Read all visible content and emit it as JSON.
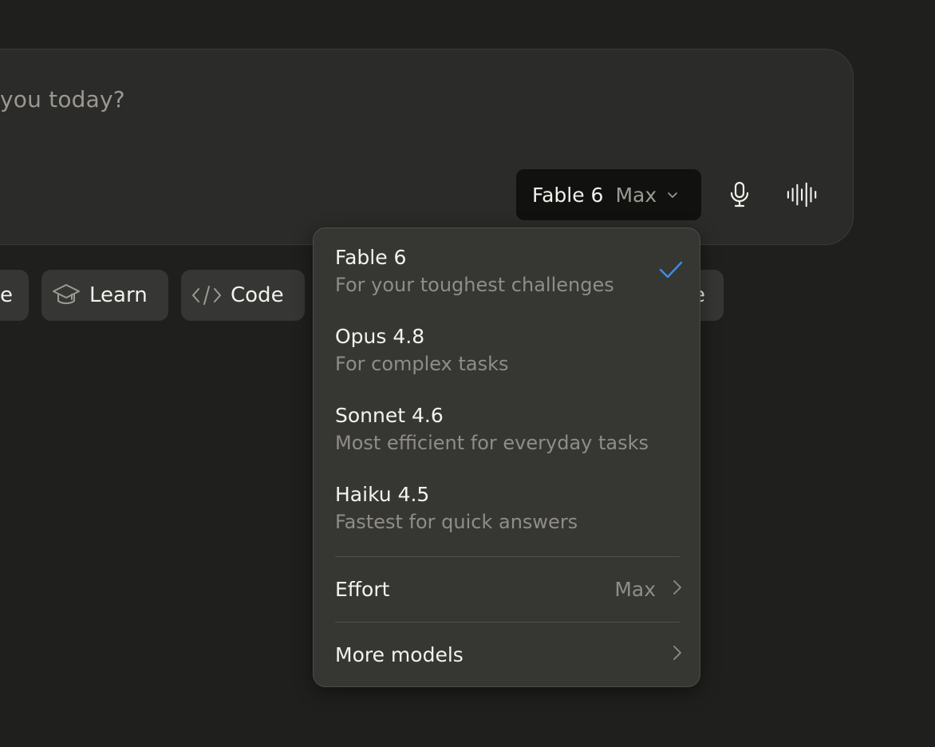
{
  "composer": {
    "placeholder": "you today?",
    "model_button": {
      "name": "Fable 6",
      "effort": "Max"
    },
    "mic_icon": "microphone-icon",
    "voice_icon": "voice-waveform-icon"
  },
  "chips": [
    {
      "label": "e"
    },
    {
      "label": "Learn",
      "icon": "graduation-cap-icon"
    },
    {
      "label": "Code",
      "icon": "code-icon"
    },
    {
      "label": "e"
    }
  ],
  "model_menu": {
    "models": [
      {
        "name": "Fable 6",
        "description": "For your toughest challenges",
        "selected": true
      },
      {
        "name": "Opus 4.8",
        "description": "For complex tasks",
        "selected": false
      },
      {
        "name": "Sonnet 4.6",
        "description": "Most efficient for everyday tasks",
        "selected": false
      },
      {
        "name": "Haiku 4.5",
        "description": "Fastest for quick answers",
        "selected": false
      }
    ],
    "effort": {
      "label": "Effort",
      "value": "Max"
    },
    "more": {
      "label": "More models"
    }
  },
  "colors": {
    "check": "#3d8fe0",
    "background": "#1f1f1e",
    "menu": "#363633"
  }
}
